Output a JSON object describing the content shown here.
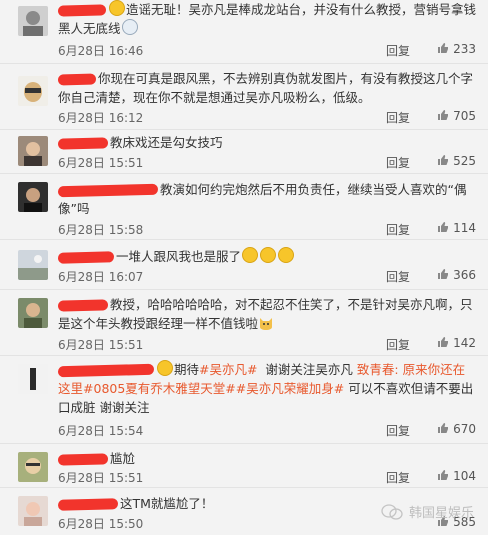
{
  "comments": [
    {
      "content": "造谣无耻！吴亦凡是棒成龙站台，并没有什么教授，营销号拿钱黑人无底线",
      "time": "6月28日 16:46",
      "reply": "回复",
      "likes": "233"
    },
    {
      "content": "你现在可真是跟风黑，不去辨别真伪就发图片，有没有教授这几个字你自己清楚，现在你不就是想通过吴亦凡吸粉么，低级。",
      "time": "6月28日 16:12",
      "reply": "回复",
      "likes": "705"
    },
    {
      "content": "教床戏还是勾女技巧",
      "time": "6月28日 15:51",
      "reply": "回复",
      "likes": "525"
    },
    {
      "content": "教演如何约完炮然后不用负责任，继续当受人喜欢的“偶像”吗",
      "time": "6月28日 15:58",
      "reply": "回复",
      "likes": "114"
    },
    {
      "content": "一堆人跟风我也是服了",
      "time": "6月28日 16:07",
      "reply": "回复",
      "likes": "366"
    },
    {
      "content": "教授，哈哈哈哈哈哈，对不起忍不住笑了，不是针对吴亦凡啊，只是这个年头教授跟经理一样不值钱啦",
      "time": "6月28日 15:51",
      "reply": "回复",
      "likes": "142"
    },
    {
      "content_a": "期待",
      "tag1": "#吴亦凡#",
      "content_b": "谢谢关注吴亦凡",
      "content_c": "致青春: 原来你还在这里",
      "tag2": "#0805夏有乔木雅望天堂#",
      "tag3": "#吴亦凡荣耀加身#",
      "content_d": "可以不喜欢但请不要出口成脏 谢谢关注",
      "time": "6月28日 15:54",
      "reply": "回复",
      "likes": "670"
    },
    {
      "content": "尴尬",
      "time": "6月28日 15:51",
      "reply": "回复",
      "likes": "104"
    },
    {
      "content": "这TM就尴尬了！",
      "time": "6月28日 15:50",
      "reply": "回复",
      "likes": "585"
    }
  ],
  "watermark": "韩国星娱乐",
  "colors": {
    "redact": "#f2342c",
    "tag": "#e8592e"
  }
}
